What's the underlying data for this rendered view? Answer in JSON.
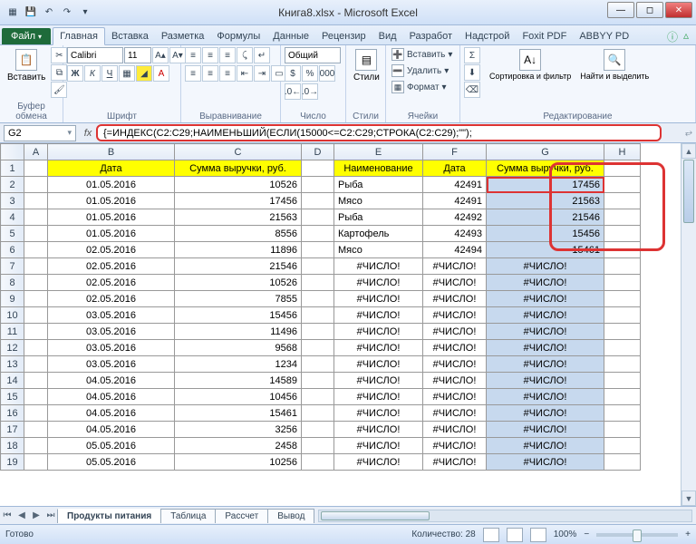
{
  "window": {
    "title": "Книга8.xlsx  -  Microsoft Excel"
  },
  "tabs": {
    "file": "Файл",
    "items": [
      "Главная",
      "Вставка",
      "Разметка",
      "Формулы",
      "Данные",
      "Рецензир",
      "Вид",
      "Разработ",
      "Надстрой",
      "Foxit PDF",
      "ABBYY PD"
    ],
    "active": 0
  },
  "ribbon": {
    "clipboard": {
      "label": "Буфер обмена",
      "paste": "Вставить"
    },
    "font": {
      "label": "Шрифт",
      "name": "Calibri",
      "size": "11"
    },
    "align": {
      "label": "Выравнивание"
    },
    "number": {
      "label": "Число",
      "format": "Общий"
    },
    "styles": {
      "label": "Стили",
      "btn": "Стили"
    },
    "cells": {
      "label": "Ячейки",
      "insert": "Вставить",
      "delete": "Удалить",
      "format": "Формат"
    },
    "editing": {
      "label": "Редактирование",
      "sort": "Сортировка и фильтр",
      "find": "Найти и выделить"
    }
  },
  "namebox": "G2",
  "formula": "{=ИНДЕКС(C2:C29;НАИМЕНЬШИЙ(ЕСЛИ(15000<=C2:C29;СТРОКА(C2:C29);\"\");",
  "columns": [
    "A",
    "B",
    "C",
    "D",
    "E",
    "F",
    "G",
    "H"
  ],
  "headers": {
    "B": "Дата",
    "C": "Сумма выручки, руб.",
    "E": "Наименование",
    "F": "Дата",
    "G": "Сумма выручки, руб."
  },
  "rows": [
    {
      "n": 2,
      "B": "01.05.2016",
      "C": 10526,
      "E": "Рыба",
      "F": 42491,
      "G": 17456
    },
    {
      "n": 3,
      "B": "01.05.2016",
      "C": 17456,
      "E": "Мясо",
      "F": 42491,
      "G": 21563
    },
    {
      "n": 4,
      "B": "01.05.2016",
      "C": 21563,
      "E": "Рыба",
      "F": 42492,
      "G": 21546
    },
    {
      "n": 5,
      "B": "01.05.2016",
      "C": 8556,
      "E": "Картофель",
      "F": 42493,
      "G": 15456
    },
    {
      "n": 6,
      "B": "02.05.2016",
      "C": 11896,
      "E": "Мясо",
      "F": 42494,
      "G": 15461
    },
    {
      "n": 7,
      "B": "02.05.2016",
      "C": 21546,
      "E": "#ЧИСЛО!",
      "F": "#ЧИСЛО!",
      "G": "#ЧИСЛО!"
    },
    {
      "n": 8,
      "B": "02.05.2016",
      "C": 10526,
      "E": "#ЧИСЛО!",
      "F": "#ЧИСЛО!",
      "G": "#ЧИСЛО!"
    },
    {
      "n": 9,
      "B": "02.05.2016",
      "C": 7855,
      "E": "#ЧИСЛО!",
      "F": "#ЧИСЛО!",
      "G": "#ЧИСЛО!"
    },
    {
      "n": 10,
      "B": "03.05.2016",
      "C": 15456,
      "E": "#ЧИСЛО!",
      "F": "#ЧИСЛО!",
      "G": "#ЧИСЛО!"
    },
    {
      "n": 11,
      "B": "03.05.2016",
      "C": 11496,
      "E": "#ЧИСЛО!",
      "F": "#ЧИСЛО!",
      "G": "#ЧИСЛО!"
    },
    {
      "n": 12,
      "B": "03.05.2016",
      "C": 9568,
      "E": "#ЧИСЛО!",
      "F": "#ЧИСЛО!",
      "G": "#ЧИСЛО!"
    },
    {
      "n": 13,
      "B": "03.05.2016",
      "C": 1234,
      "E": "#ЧИСЛО!",
      "F": "#ЧИСЛО!",
      "G": "#ЧИСЛО!"
    },
    {
      "n": 14,
      "B": "04.05.2016",
      "C": 14589,
      "E": "#ЧИСЛО!",
      "F": "#ЧИСЛО!",
      "G": "#ЧИСЛО!"
    },
    {
      "n": 15,
      "B": "04.05.2016",
      "C": 10456,
      "E": "#ЧИСЛО!",
      "F": "#ЧИСЛО!",
      "G": "#ЧИСЛО!"
    },
    {
      "n": 16,
      "B": "04.05.2016",
      "C": 15461,
      "E": "#ЧИСЛО!",
      "F": "#ЧИСЛО!",
      "G": "#ЧИСЛО!"
    },
    {
      "n": 17,
      "B": "04.05.2016",
      "C": 3256,
      "E": "#ЧИСЛО!",
      "F": "#ЧИСЛО!",
      "G": "#ЧИСЛО!"
    },
    {
      "n": 18,
      "B": "05.05.2016",
      "C": 2458,
      "E": "#ЧИСЛО!",
      "F": "#ЧИСЛО!",
      "G": "#ЧИСЛО!"
    },
    {
      "n": 19,
      "B": "05.05.2016",
      "C": 10256,
      "E": "#ЧИСЛО!",
      "F": "#ЧИСЛО!",
      "G": "#ЧИСЛО!"
    }
  ],
  "sheets": [
    "Продукты питания",
    "Таблица",
    "Рассчет",
    "Вывод"
  ],
  "active_sheet": 0,
  "status": {
    "ready": "Готово",
    "count_label": "Количество:",
    "count": 28,
    "zoom": "100%"
  },
  "chart_data": {
    "type": "table",
    "note": "spreadsheet data above"
  }
}
